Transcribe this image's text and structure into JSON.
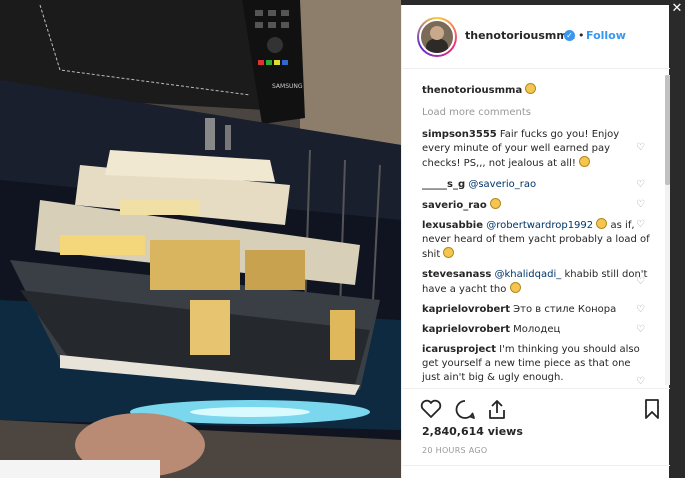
{
  "post": {
    "username": "thenotoriousmma",
    "follow_label": "Follow",
    "separator": "•",
    "verified_glyph": "✓"
  },
  "caption": {
    "username": "thenotoriousmma"
  },
  "load_more_label": "Load more comments",
  "comments": [
    {
      "user": "simpson3555",
      "text": "Fair fucks go you! Enjoy every minute of your well earned pay checks! PS,,, not jealous at all!"
    },
    {
      "user": "_____s_g",
      "mention": "@saverio_rao",
      "text": ""
    },
    {
      "user": "saverio_rao",
      "text": ""
    },
    {
      "user": "lexusabbie",
      "mention": "@robertwardrop1992",
      "text": "as if, never heard of them yacht probably a load of shit"
    },
    {
      "user": "stevesanass",
      "mention": "@khalidqadi_",
      "text": "khabib still don't have a yacht tho"
    },
    {
      "user": "kaprielovrobert",
      "text": "Это в стиле Конора"
    },
    {
      "user": "kaprielovrobert",
      "text": "Молодец"
    },
    {
      "user": "icarusproject",
      "text": "I'm thinking you should also get yourself a new time piece as that one just ain't big & ugly enough."
    }
  ],
  "stats": {
    "views": "2,840,614 views",
    "time_ago": "20 HOURS AGO"
  },
  "remote_brand": "SAMSUNG",
  "close_glyph": "✕",
  "heart_glyph": "♡",
  "colors": {
    "link_blue": "#3897f0",
    "text_dark": "#262626",
    "muted": "#999999"
  }
}
